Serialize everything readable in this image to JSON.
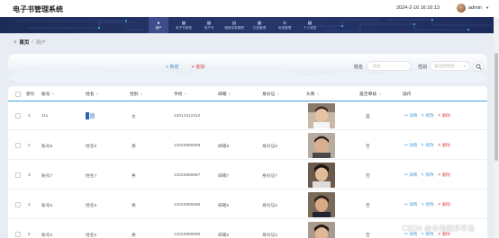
{
  "app": {
    "title": "电子书管理系统"
  },
  "header": {
    "datetime": "2024-2-16 16:16:13",
    "user": "admin"
  },
  "nav": {
    "items": [
      {
        "label": "用户",
        "icon": "user-icon",
        "active": true
      },
      {
        "label": "电子书类型",
        "icon": "grid-icon",
        "active": false
      },
      {
        "label": "电子书",
        "icon": "grid-icon",
        "active": false
      },
      {
        "label": "借阅信息管理",
        "icon": "document-icon",
        "active": false
      },
      {
        "label": "归还管理",
        "icon": "grid-icon",
        "active": false
      },
      {
        "label": "系统管理",
        "icon": "gear-icon",
        "active": false
      },
      {
        "label": "个人信息",
        "icon": "grid-icon",
        "active": false
      }
    ]
  },
  "breadcrumb": {
    "home": "首页",
    "current": "用户"
  },
  "toolbar": {
    "add_label": "新增",
    "delete_label": "删除"
  },
  "search": {
    "name_label": "姓名",
    "name_placeholder": "姓名",
    "gender_label": "性别",
    "gender_placeholder": "请选择性别"
  },
  "table": {
    "columns": [
      "索引",
      "账号",
      "姓名",
      "性别",
      "手机",
      "邮箱",
      "身份证",
      "头像",
      "是否审核",
      "操作"
    ],
    "actions": {
      "detail": "详情",
      "edit": "修改",
      "delete": "删除"
    },
    "rows": [
      {
        "index": "1",
        "account": "111",
        "name": "",
        "gender": "女",
        "phone": "13012312312",
        "email": "",
        "idcard": "",
        "audit": "是",
        "photo": "p1"
      },
      {
        "index": "2",
        "account": "账号8",
        "name": "姓名8",
        "gender": "男",
        "phone": "13023888888",
        "email": "邮箱8",
        "idcard": "身份证8",
        "audit": "否",
        "photo": "p2"
      },
      {
        "index": "3",
        "account": "账号7",
        "name": "姓名7",
        "gender": "男",
        "phone": "13023888887",
        "email": "邮箱7",
        "idcard": "身份证7",
        "audit": "否",
        "photo": "p3"
      },
      {
        "index": "4",
        "account": "账号6",
        "name": "姓名6",
        "gender": "男",
        "phone": "13023888886",
        "email": "邮箱6",
        "idcard": "身份证6",
        "audit": "否",
        "photo": "p4"
      },
      {
        "index": "5",
        "account": "账号5",
        "name": "姓名5",
        "gender": "男",
        "phone": "13023888885",
        "email": "邮箱5",
        "idcard": "身份证5",
        "audit": "否",
        "photo": "p5"
      }
    ]
  },
  "watermark": "CSDN @全栈程序毕设"
}
